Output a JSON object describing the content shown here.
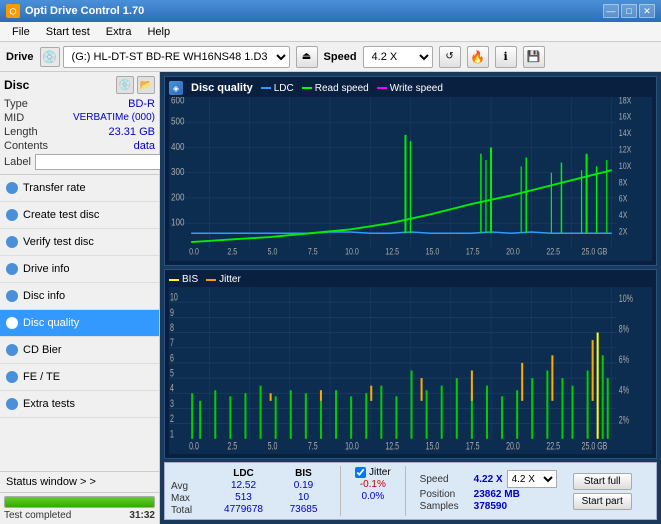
{
  "app": {
    "title": "Opti Drive Control 1.70",
    "icon": "⬡"
  },
  "title_controls": {
    "minimize": "—",
    "maximize": "□",
    "close": "✕"
  },
  "menu": {
    "items": [
      "File",
      "Start test",
      "Extra",
      "Help"
    ]
  },
  "drive_bar": {
    "label": "Drive",
    "drive_value": "(G:) HL-DT-ST BD-RE  WH16NS48 1.D3",
    "speed_label": "Speed",
    "speed_value": "4.2 X",
    "eject_icon": "⏏"
  },
  "disc": {
    "title": "Disc",
    "type_label": "Type",
    "type_value": "BD-R",
    "mid_label": "MID",
    "mid_value": "VERBATIMe (000)",
    "length_label": "Length",
    "length_value": "23.31 GB",
    "contents_label": "Contents",
    "contents_value": "data",
    "label_label": "Label",
    "label_value": ""
  },
  "nav": {
    "items": [
      {
        "id": "transfer-rate",
        "label": "Transfer rate",
        "active": false
      },
      {
        "id": "create-test-disc",
        "label": "Create test disc",
        "active": false
      },
      {
        "id": "verify-test-disc",
        "label": "Verify test disc",
        "active": false
      },
      {
        "id": "drive-info",
        "label": "Drive info",
        "active": false
      },
      {
        "id": "disc-info",
        "label": "Disc info",
        "active": false
      },
      {
        "id": "disc-quality",
        "label": "Disc quality",
        "active": true
      },
      {
        "id": "cd-bier",
        "label": "CD Bier",
        "active": false
      },
      {
        "id": "fe-te",
        "label": "FE / TE",
        "active": false
      },
      {
        "id": "extra-tests",
        "label": "Extra tests",
        "active": false
      }
    ]
  },
  "status_window": {
    "label": "Status window > >"
  },
  "progress": {
    "value": 100,
    "text": "Test completed",
    "time": "31:32"
  },
  "chart_quality": {
    "title": "Disc quality",
    "panel_icon": "◈",
    "legend": [
      {
        "id": "ldc",
        "label": "LDC",
        "color": "#3399ff"
      },
      {
        "id": "read",
        "label": "Read speed",
        "color": "#00ff00"
      },
      {
        "id": "write",
        "label": "Write speed",
        "color": "#ff00ff"
      }
    ],
    "y_axis_left": [
      "600",
      "500",
      "400",
      "300",
      "200",
      "100"
    ],
    "y_axis_right": [
      "18X",
      "16X",
      "14X",
      "12X",
      "10X",
      "8X",
      "6X",
      "4X",
      "2X"
    ],
    "x_axis": [
      "0.0",
      "2.5",
      "5.0",
      "7.5",
      "10.0",
      "12.5",
      "15.0",
      "17.5",
      "20.0",
      "22.5",
      "25.0 GB"
    ]
  },
  "chart_bis": {
    "legend": [
      {
        "id": "bis",
        "label": "BIS",
        "color": "#ffff00"
      },
      {
        "id": "jitter",
        "label": "Jitter",
        "color": "#ff9900"
      }
    ],
    "y_axis_left": [
      "10",
      "9",
      "8",
      "7",
      "6",
      "5",
      "4",
      "3",
      "2",
      "1"
    ],
    "y_axis_right": [
      "10%",
      "8%",
      "6%",
      "4%",
      "2%"
    ],
    "x_axis": [
      "0.0",
      "2.5",
      "5.0",
      "7.5",
      "10.0",
      "12.5",
      "15.0",
      "17.5",
      "20.0",
      "22.5",
      "25.0 GB"
    ]
  },
  "stats": {
    "columns": [
      "LDC",
      "BIS",
      "",
      "Jitter",
      "Speed",
      ""
    ],
    "avg_label": "Avg",
    "avg_ldc": "12.52",
    "avg_bis": "0.19",
    "avg_jitter": "-0.1%",
    "max_label": "Max",
    "max_ldc": "513",
    "max_bis": "10",
    "max_jitter": "0.0%",
    "total_label": "Total",
    "total_ldc": "4779678",
    "total_bis": "73685",
    "jitter_checked": true,
    "jitter_label": "Jitter",
    "speed_label": "Speed",
    "speed_value": "4.22 X",
    "speed_select": "4.2 X",
    "position_label": "Position",
    "position_value": "23862 MB",
    "samples_label": "Samples",
    "samples_value": "378590",
    "btn_start_full": "Start full",
    "btn_start_part": "Start part"
  }
}
